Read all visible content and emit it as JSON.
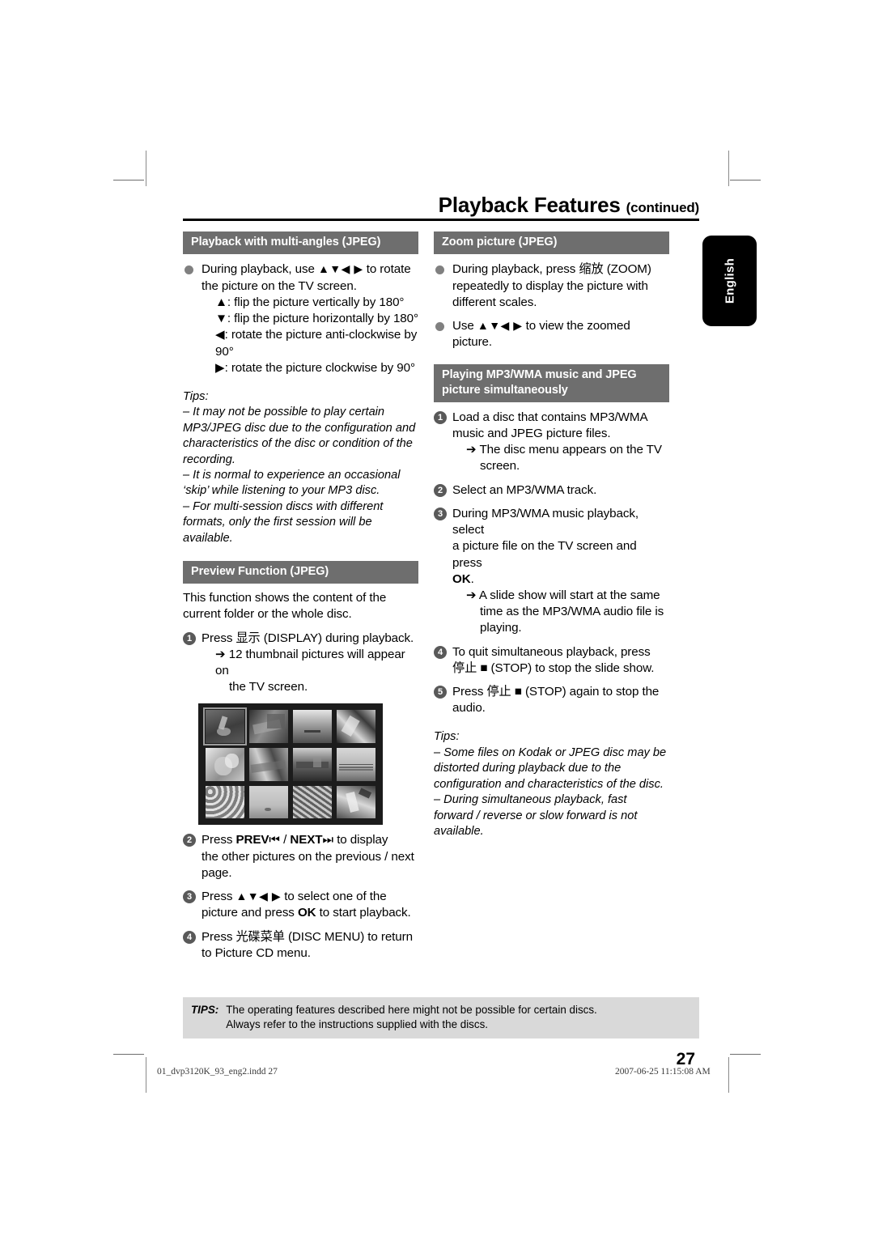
{
  "running_head": {
    "title": "Playback Features",
    "continued": "(continued)"
  },
  "side_tab": {
    "label": "English"
  },
  "left_column": {
    "section_multi_angles": {
      "heading": "Playback with multi-angles (JPEG)",
      "bullet_1_line_1": "During playback, use",
      "bullet_1_arrows": "▲▼◀ ▶",
      "bullet_1_line_1_end": "to rotate",
      "bullet_1_line_2": "the picture on the TV screen.",
      "detail_up": "▲: flip the picture vertically by 180°",
      "detail_down": "▼: flip the picture horizontally by 180°",
      "detail_left": "◀: rotate the picture anti-clockwise by",
      "detail_left_cont": "90°",
      "detail_right": "▶: rotate the picture clockwise by 90°"
    },
    "tips": {
      "label": "Tips:",
      "items": [
        "– It may not be possible to play certain MP3/JPEG disc due to the configuration and characteristics of the disc or condition of the recording.",
        "– It is normal to experience an occasional ‘skip’ while listening to your MP3 disc.",
        "– For multi-session discs with different formats, only the first session will be available."
      ]
    },
    "section_preview": {
      "heading": "Preview Function (JPEG)",
      "intro": "This function shows the content of the current folder or the whole disc.",
      "step_1_num": "1",
      "step_1_text_a": "Press",
      "step_1_cjk": "显示",
      "step_1_text_b": "(DISPLAY) during playback.",
      "step_1_result_line_1": "➔ 12 thumbnail pictures will appear on",
      "step_1_result_line_2": "the TV screen.",
      "step_2_num": "2",
      "step_2_a": "Press",
      "step_2_prev": "PREV",
      "step_2_prev_icon": "⏮",
      "step_2_slash": "/",
      "step_2_next": "NEXT",
      "step_2_next_icon": "⏭",
      "step_2_b": "to display",
      "step_2_line_2": "the other pictures on the previous / next",
      "step_2_line_3": "page.",
      "step_3_num": "3",
      "step_3_a": "Press",
      "step_3_arrows": "▲▼◀ ▶",
      "step_3_b": "to select one of the",
      "step_3_line_2_a": "picture and press",
      "step_3_ok": "OK",
      "step_3_line_2_b": "to start playback.",
      "step_4_num": "4",
      "step_4_a": "Press",
      "step_4_cjk": "光碟菜单",
      "step_4_b": "(DISC MENU) to return",
      "step_4_line_2": "to Picture CD menu."
    },
    "screenshot": {
      "name": "jpeg-thumbnail-preview",
      "rows": 3,
      "cols": 4,
      "selected_index": 0,
      "background": "#1c1c1c"
    }
  },
  "right_column": {
    "section_zoom": {
      "heading": "Zoom picture (JPEG)",
      "bullet_1_a": "During playback, press",
      "bullet_1_cjk": "缩放",
      "bullet_1_b": "(ZOOM)",
      "bullet_1_line_2": "repeatedly to display the picture with",
      "bullet_1_line_3": "different scales.",
      "bullet_2_a": "Use",
      "bullet_2_arrows": "▲▼◀ ▶",
      "bullet_2_b": "to view the zoomed",
      "bullet_2_line_2": "picture."
    },
    "section_simultaneous": {
      "heading_line_1": "Playing MP3/WMA music and JPEG",
      "heading_line_2": "picture simultaneously",
      "step_1_num": "1",
      "step_1_line_1": "Load a disc that contains MP3/WMA",
      "step_1_line_2": "music and JPEG picture files.",
      "step_1_result_line_1": "➔ The disc menu appears on the TV",
      "step_1_result_line_2": "screen.",
      "step_2_num": "2",
      "step_2_text": "Select an MP3/WMA track.",
      "step_3_num": "3",
      "step_3_line_1": "During MP3/WMA music playback, select",
      "step_3_line_2": "a picture file on the TV screen and press",
      "step_3_ok": "OK",
      "step_3_period": ".",
      "step_3_result_line_1": "➔ A slide show will start at the same",
      "step_3_result_line_2": "time as the MP3/WMA audio file is",
      "step_3_result_line_3": "playing.",
      "step_4_num": "4",
      "step_4_line_1": "To quit simultaneous playback, press",
      "step_4_cjk": "停止",
      "step_4_stop_icon": "■",
      "step_4_line_2_b": "(STOP) to stop the slide show.",
      "step_5_num": "5",
      "step_5_a": "Press",
      "step_5_cjk": "停止",
      "step_5_stop_icon": "■",
      "step_5_b": "(STOP) again to stop the",
      "step_5_line_2": "audio."
    },
    "tips": {
      "label": "Tips:",
      "items": [
        "– Some files on Kodak or JPEG disc may be distorted during playback due to the configuration and characteristics of the disc.",
        "– During simultaneous playback, fast forward / reverse or slow forward is not available."
      ]
    }
  },
  "footer": {
    "tips_label": "TIPS:",
    "tips_line_1": "The operating features described here might not be possible for certain discs.",
    "tips_line_2": "Always refer to the instructions supplied with the discs.",
    "page_number": "27"
  },
  "print_slug": {
    "file": "01_dvp3120K_93_eng2.indd   27",
    "timestamp": "2007-06-25   11:15:08 AM"
  },
  "colors": {
    "section_header_bg": "#6e6e6e",
    "tips_box_bg": "#d9d9d9",
    "marker_gray": "#595959",
    "bullet_gray": "#808080"
  }
}
